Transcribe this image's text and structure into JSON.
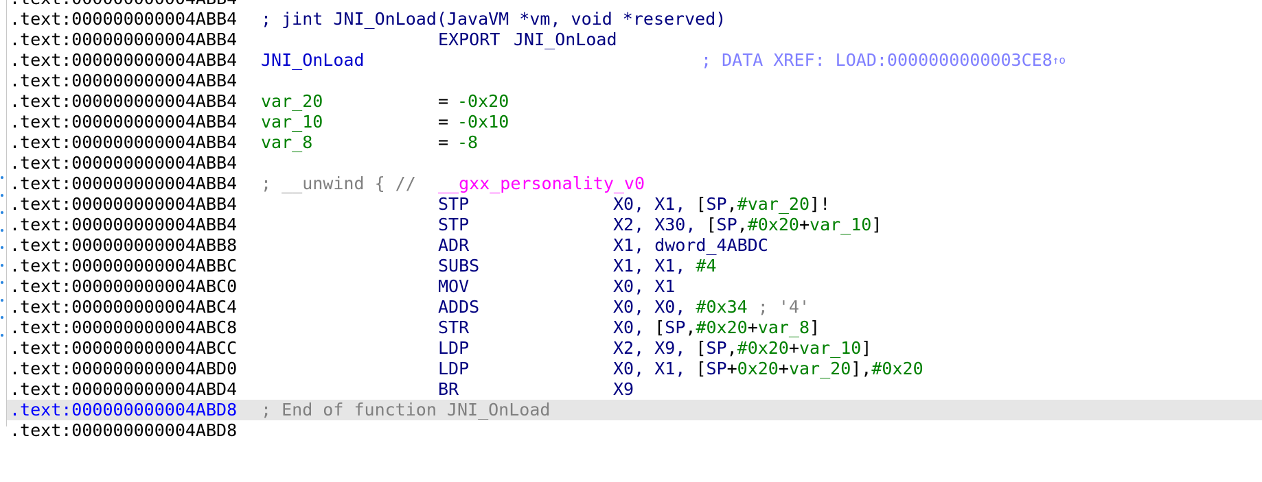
{
  "segment": ".text",
  "top_partial_address": ".text:000000000004ABB4",
  "bottom_partial_address": ".text:000000000004ABD8",
  "header": {
    "prototype_comment": "; jint JNI_OnLoad(JavaVM *vm, void *reserved)",
    "export_directive": "EXPORT",
    "export_name": "JNI_OnLoad",
    "func_label": "JNI_OnLoad",
    "xref_comment": "; DATA XREF: LOAD:0000000000003CE8",
    "xref_arrow": "↑o"
  },
  "stack_vars": [
    {
      "name": "var_20",
      "eq": "=",
      "value": "-0x20"
    },
    {
      "name": "var_10",
      "eq": "=",
      "value": "-0x10"
    },
    {
      "name": "var_8",
      "eq": "=",
      "value": "-8"
    }
  ],
  "unwind": {
    "prefix": "; __unwind { // ",
    "personality": "__gxx_personality_v0"
  },
  "addresses": [
    ".text:000000000004ABB4",
    ".text:000000000004ABB4",
    ".text:000000000004ABB4",
    ".text:000000000004ABB4",
    ".text:000000000004ABB4",
    ".text:000000000004ABB4",
    ".text:000000000004ABB4",
    ".text:000000000004ABB4",
    ".text:000000000004ABB4",
    ".text:000000000004ABB4",
    ".text:000000000004ABB4",
    ".text:000000000004ABB8",
    ".text:000000000004ABBC",
    ".text:000000000004ABC0",
    ".text:000000000004ABC4",
    ".text:000000000004ABC8",
    ".text:000000000004ABCC",
    ".text:000000000004ABD0",
    ".text:000000000004ABD4",
    ".text:000000000004ABD8",
    ".text:000000000004ABD8"
  ],
  "instructions": [
    {
      "mnemonic": "STP",
      "ops": [
        [
          "reg",
          "X0, X1, "
        ],
        [
          "br",
          "["
        ],
        [
          "reg",
          "SP"
        ],
        [
          "br",
          ","
        ],
        [
          "num",
          "#"
        ],
        [
          "var",
          "var_20"
        ],
        [
          "br",
          "]!"
        ]
      ]
    },
    {
      "mnemonic": "STP",
      "ops": [
        [
          "reg",
          "X2, X30, "
        ],
        [
          "br",
          "["
        ],
        [
          "reg",
          "SP"
        ],
        [
          "br",
          ","
        ],
        [
          "num",
          "#0x20"
        ],
        [
          "br",
          "+"
        ],
        [
          "var",
          "var_10"
        ],
        [
          "br",
          "]"
        ]
      ]
    },
    {
      "mnemonic": "ADR",
      "ops": [
        [
          "reg",
          "X1, "
        ],
        [
          "ref",
          "dword_4ABDC"
        ]
      ]
    },
    {
      "mnemonic": "SUBS",
      "ops": [
        [
          "reg",
          "X1, X1, "
        ],
        [
          "num",
          "#4"
        ]
      ]
    },
    {
      "mnemonic": "MOV",
      "ops": [
        [
          "reg",
          "X0, X1"
        ]
      ]
    },
    {
      "mnemonic": "ADDS",
      "ops": [
        [
          "reg",
          "X0, X0, "
        ],
        [
          "num",
          "#0x34"
        ],
        [
          "com",
          " ; '4'"
        ]
      ]
    },
    {
      "mnemonic": "STR",
      "ops": [
        [
          "reg",
          "X0, "
        ],
        [
          "br",
          "["
        ],
        [
          "reg",
          "SP"
        ],
        [
          "br",
          ","
        ],
        [
          "num",
          "#0x20"
        ],
        [
          "br",
          "+"
        ],
        [
          "var",
          "var_8"
        ],
        [
          "br",
          "]"
        ]
      ]
    },
    {
      "mnemonic": "LDP",
      "ops": [
        [
          "reg",
          "X2, X9, "
        ],
        [
          "br",
          "["
        ],
        [
          "reg",
          "SP"
        ],
        [
          "br",
          ","
        ],
        [
          "num",
          "#0x20"
        ],
        [
          "br",
          "+"
        ],
        [
          "var",
          "var_10"
        ],
        [
          "br",
          "]"
        ]
      ]
    },
    {
      "mnemonic": "LDP",
      "ops": [
        [
          "reg",
          "X0, X1, "
        ],
        [
          "br",
          "["
        ],
        [
          "reg",
          "SP"
        ],
        [
          "br",
          "+"
        ],
        [
          "num",
          "0x20"
        ],
        [
          "br",
          "+"
        ],
        [
          "var",
          "var_20"
        ],
        [
          "br",
          "],"
        ],
        [
          "num",
          "#0x20"
        ]
      ]
    },
    {
      "mnemonic": "BR",
      "ops": [
        [
          "reg",
          "X9"
        ]
      ]
    }
  ],
  "end_comment": "; End of function JNI_OnLoad",
  "colors": {
    "highlight_row": "#e6e6e6",
    "address_highlight": "#0000ff",
    "comment": "#808080",
    "number": "#008000",
    "register": "#000080",
    "personality": "#ff00ff",
    "xref": "#8080ff"
  }
}
